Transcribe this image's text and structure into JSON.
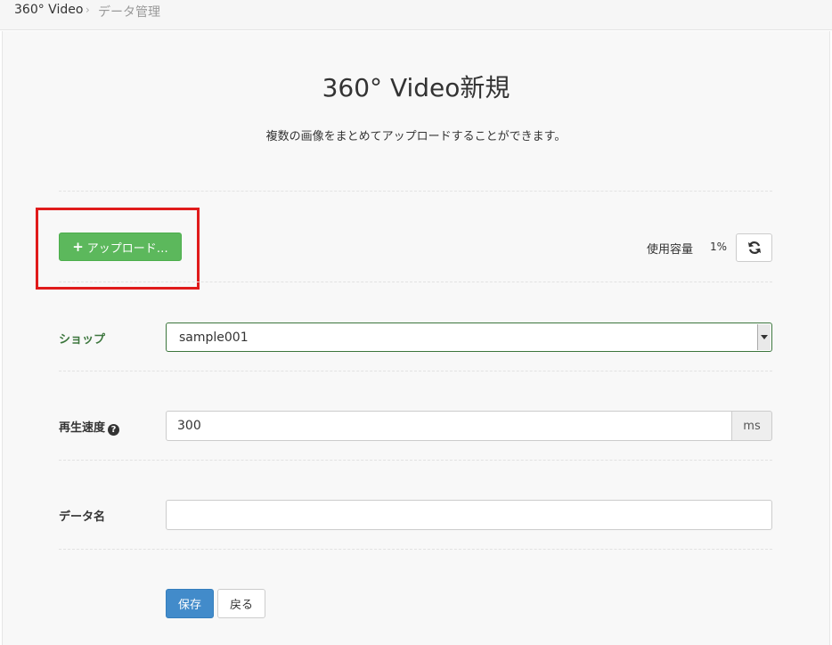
{
  "breadcrumb": {
    "root": "360° Video",
    "separator": "›",
    "current": "データ管理"
  },
  "page": {
    "title": "360° Video新規",
    "description": "複数の画像をまとめてアップロードすることができます。"
  },
  "upload": {
    "button_icon": "plus-icon",
    "button_label": "アップロード…",
    "usage_label": "使用容量",
    "usage_value": "1%",
    "refresh_icon": "refresh-icon"
  },
  "form": {
    "shop": {
      "label": "ショップ",
      "selected": "sample001"
    },
    "speed": {
      "label": "再生速度",
      "help_icon": "question-circle-icon",
      "value": "300",
      "unit": "ms"
    },
    "data_name": {
      "label": "データ名",
      "value": ""
    }
  },
  "actions": {
    "save_label": "保存",
    "back_label": "戻る"
  },
  "colors": {
    "success": "#5cb85c",
    "primary": "#428bca",
    "label_green": "#3c763d",
    "highlight": "#e01b1b"
  }
}
